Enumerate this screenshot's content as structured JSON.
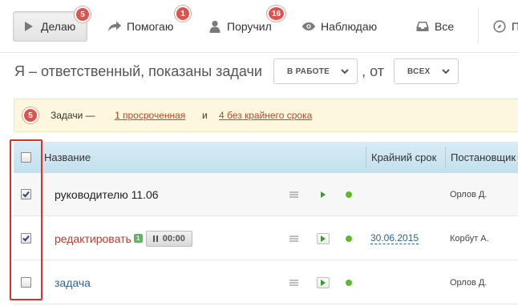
{
  "tabs": [
    {
      "label": "Делаю",
      "badge": "5",
      "icon": "play-icon"
    },
    {
      "label": "Помогаю",
      "badge": "1",
      "icon": "share-arrow-icon"
    },
    {
      "label": "Поручил",
      "badge": "16",
      "icon": "person-icon"
    },
    {
      "label": "Наблюдаю",
      "badge": "",
      "icon": "eye-icon"
    },
    {
      "label": "Все",
      "badge": "",
      "icon": "inbox-icon"
    },
    {
      "label": "П",
      "badge": "",
      "icon": "compass-icon"
    }
  ],
  "filter": {
    "prefix": "Я – ответственный, показаны задачи",
    "status_value": "В РАБОТЕ",
    "separator": ", от",
    "from_value": "ВСЕХ"
  },
  "notice": {
    "badge": "5",
    "prefix": "Задачи —",
    "link_overdue": "1 просроченная",
    "conjunction": "и",
    "link_no_deadline": "4 без крайнего срока"
  },
  "table": {
    "headers": {
      "name": "Название",
      "deadline": "Крайний срок",
      "creator": "Постановщик"
    },
    "rows": [
      {
        "name": "руководителю 11.06",
        "name_color": "#222222",
        "checked": true,
        "badge": "",
        "timer": "",
        "deadline": "",
        "creator": "Орлов Д."
      },
      {
        "name": "редактировать",
        "name_color": "#c0392b",
        "checked": true,
        "badge": "1",
        "timer": "00:00",
        "deadline": "30.06.2015",
        "creator": "Корбут А."
      },
      {
        "name": "задача",
        "name_color": "#2a6496",
        "checked": false,
        "badge": "",
        "timer": "",
        "deadline": "",
        "creator": "Орлов Д."
      }
    ]
  },
  "colors": {
    "badge": "#e0524b",
    "header_bg": "#c9e4f1",
    "notice_bg": "#fcf7dd",
    "status_dot": "#5dba2e",
    "highlight_frame": "#d8322c"
  }
}
